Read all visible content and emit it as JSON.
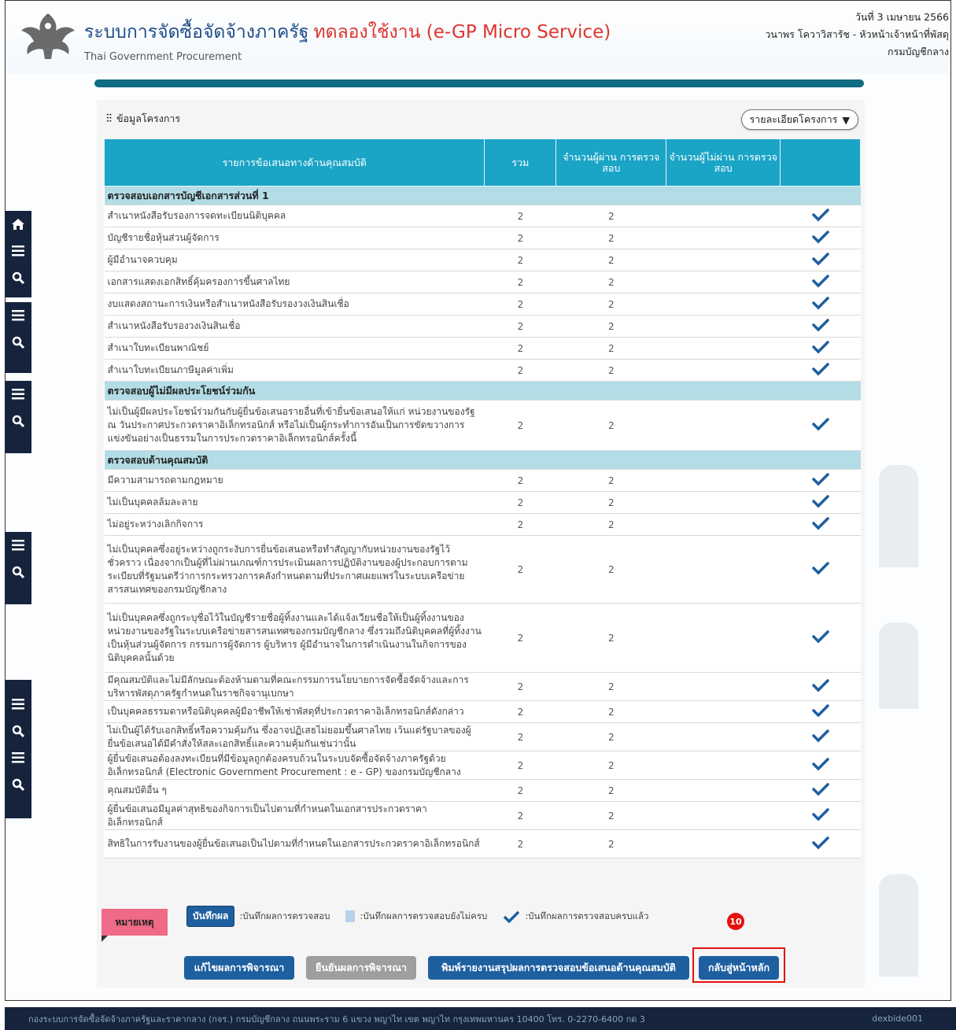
{
  "header": {
    "title": "ระบบการจัดซื้อจัดจ้างภาครัฐ",
    "trial_label": "ทดลองใช้งาน (e-GP Micro Service)",
    "subtitle": "Thai Government Procurement",
    "date": "วันที่ 3 เมษายน 2566",
    "user": "วนาพร โควาวิสารัช - หัวหน้าเจ้าหน้าที่พัสดุ",
    "org": "กรมบัญชีกลาง"
  },
  "panel": {
    "title": "ข้อมูลโครงการ",
    "details_button": "รายละเอียดโครงการ"
  },
  "table": {
    "headers": {
      "item": "รายการข้อเสนอทางด้านคุณสมบัติ",
      "total": "รวม",
      "passed": "จำนวนผู้ผ่าน การตรวจสอบ",
      "failed": "จำนวนผู้ไม่ผ่าน การตรวจสอบ"
    },
    "groups": [
      {
        "title": "ตรวจสอบเอกสารบัญชีเอกสารส่วนที่ 1",
        "rows": [
          {
            "label": "สำเนาหนังสือรับรองการจดทะเบียนนิติบุคคล",
            "total": "2",
            "passed": "2"
          },
          {
            "label": "บัญชีรายชื่อหุ้นส่วนผู้จัดการ",
            "total": "2",
            "passed": "2"
          },
          {
            "label": "ผู้มีอำนาจควบคุม",
            "total": "2",
            "passed": "2"
          },
          {
            "label": "เอกสารแสดงเอกสิทธิ์คุ้มครองการขึ้นศาลไทย",
            "total": "2",
            "passed": "2"
          },
          {
            "label": "งบแสดงสถานะการเงินหรือสำเนาหนังสือรับรองวงเงินสินเชื่อ",
            "total": "2",
            "passed": "2"
          },
          {
            "label": "สำเนาหนังสือรับรองวงเงินสินเชื่อ",
            "total": "2",
            "passed": "2"
          },
          {
            "label": "สำเนาใบทะเบียนพาณิชย์",
            "total": "2",
            "passed": "2"
          },
          {
            "label": "สำเนาใบทะเบียนภาษีมูลค่าเพิ่ม",
            "total": "2",
            "passed": "2"
          }
        ]
      },
      {
        "title": "ตรวจสอบผู้ไม่มีผลประโยชน์ร่วมกัน",
        "rows": [
          {
            "label": "ไม่เป็นผู้มีผลประโยชน์ร่วมกันกับผู้ยื่นข้อเสนอรายอื่นที่เข้ายื่นข้อเสนอให้แก่ หน่วยงานของรัฐ ณ วันประกาศประกวดราคาอิเล็กทรอนิกส์ หรือไม่เป็นผู้กระทำการอันเป็นการขัดขวางการแข่งขันอย่างเป็นธรรมในการประกวดราคาอิเล็กทรอนิกส์ครั้งนี้",
            "total": "2",
            "passed": "2"
          }
        ]
      },
      {
        "title": "ตรวจสอบด้านคุณสมบัติ",
        "rows": [
          {
            "label": "มีความสามารถตามกฎหมาย",
            "total": "2",
            "passed": "2"
          },
          {
            "label": "ไม่เป็นบุคคลล้มละลาย",
            "total": "2",
            "passed": "2"
          },
          {
            "label": "ไม่อยู่ระหว่างเลิกกิจการ",
            "total": "2",
            "passed": "2"
          },
          {
            "label": "ไม่เป็นบุคคลซึ่งอยู่ระหว่างถูกระงับการยื่นข้อเสนอหรือทำสัญญากับหน่วยงานของรัฐไว้ชั่วคราว เนื่องจากเป็นผู้ที่ไม่ผ่านเกณฑ์การประเมินผลการปฏิบัติงานของผู้ประกอบการตามระเบียบที่รัฐมนตรีว่าการกระทรวงการคลังกำหนดตามที่ประกาศเผยแพร่ในระบบเครือข่ายสารสนเทศของกรมบัญชีกลาง",
            "total": "2",
            "passed": "2"
          },
          {
            "label": "ไม่เป็นบุคคลซึ่งถูกระบุชื่อไว้ในบัญชีรายชื่อผู้ทิ้งงานและได้แจ้งเวียนชื่อให้เป็นผู้ทิ้งงานของหน่วยงานของรัฐในระบบเครือข่ายสารสนเทศของกรมบัญชีกลาง ซึ่งรวมถึงนิติบุคคลที่ผู้ทิ้งงานเป็นหุ้นส่วนผู้จัดการ กรรมการผู้จัดการ ผู้บริหาร ผู้มีอำนาจในการดำเนินงานในกิจการของนิติบุคคลนั้นด้วย",
            "total": "2",
            "passed": "2"
          },
          {
            "label": "มีคุณสมบัติและไม่มีลักษณะต้องห้ามตามที่คณะกรรมการนโยบายการจัดซื้อจัดจ้างและการบริหารพัสดุภาครัฐกำหนดในราชกิจจานุเบกษา",
            "total": "2",
            "passed": "2"
          },
          {
            "label": "เป็นบุคคลธรรมดาหรือนิติบุคคลผู้มีอาชีพให้เช่าพัสดุที่ประกวดราคาอิเล็กทรอนิกส์ดังกล่าว",
            "total": "2",
            "passed": "2"
          },
          {
            "label": "ไม่เป็นผู้ได้รับเอกสิทธิ์หรือความคุ้มกัน ซึ่งอาจปฏิเสธไม่ยอมขึ้นศาลไทย เว้นแต่รัฐบาลของผู้ยื่นข้อเสนอได้มีคำสั่งให้สละเอกสิทธิ์และความคุ้มกันเช่นว่านั้น",
            "total": "2",
            "passed": "2"
          },
          {
            "label": "ผู้ยื่นข้อเสนอต้องลงทะเบียนที่มีข้อมูลถูกต้องครบถ้วนในระบบจัดซื้อจัดจ้างภาครัฐด้วยอิเล็กทรอนิกส์ (Electronic Government Procurement : e - GP) ของกรมบัญชีกลาง",
            "total": "2",
            "passed": "2"
          },
          {
            "label": "คุณสมบัติอื่น ๆ",
            "total": "2",
            "passed": "2"
          },
          {
            "label": "ผู้ยื่นข้อเสนอมีมูลค่าสุทธิของกิจการเป็นไปตามที่กำหนดในเอกสารประกวดราคาอิเล็กทรอนิกส์",
            "total": "2",
            "passed": "2"
          },
          {
            "label": "สิทธิในการรับงานของผู้ยื่นข้อเสนอเป็นไปตามที่กำหนดในเอกสารประกวดราคาอิเล็กทรอนิกส์",
            "total": "2",
            "passed": "2"
          }
        ]
      }
    ]
  },
  "legend": {
    "note_label": "หมายเหตุ",
    "save_button": "บันทึกผล",
    "save_desc": ":บันทึกผลการตรวจสอบ",
    "incomplete_desc": ":บันทึกผลการตรวจสอบยังไม่ครบ",
    "complete_desc": ":บันทึกผลการตรวจสอบครบแล้ว",
    "step_number": "10"
  },
  "actions": {
    "edit": "แก้ไขผลการพิจารณา",
    "confirm": "ยืนยันผลการพิจารณา",
    "print": "พิมพ์รายงานสรุปผลการตรวจสอบข้อเสนอด้านคุณสมบัติ",
    "home": "กลับสู่หน้าหลัก"
  },
  "footer": {
    "address": "กองระบบการจัดซื้อจัดจ้างภาครัฐและราคากลาง (กจร.) กรมบัญชีกลาง ถนนพระราม 6 แขวง พญาไท เขต พญาไท กรุงเทพมหานคร 10400 โทร. 0-2270-6400 กด 3",
    "code": "dexbide001"
  },
  "colors": {
    "header_blue": "#1aa4c6",
    "group_bg": "#b3dde6",
    "primary": "#1e5fa0",
    "check": "#1e5fa0",
    "highlight": "#e5110d",
    "dark": "#15243c"
  }
}
